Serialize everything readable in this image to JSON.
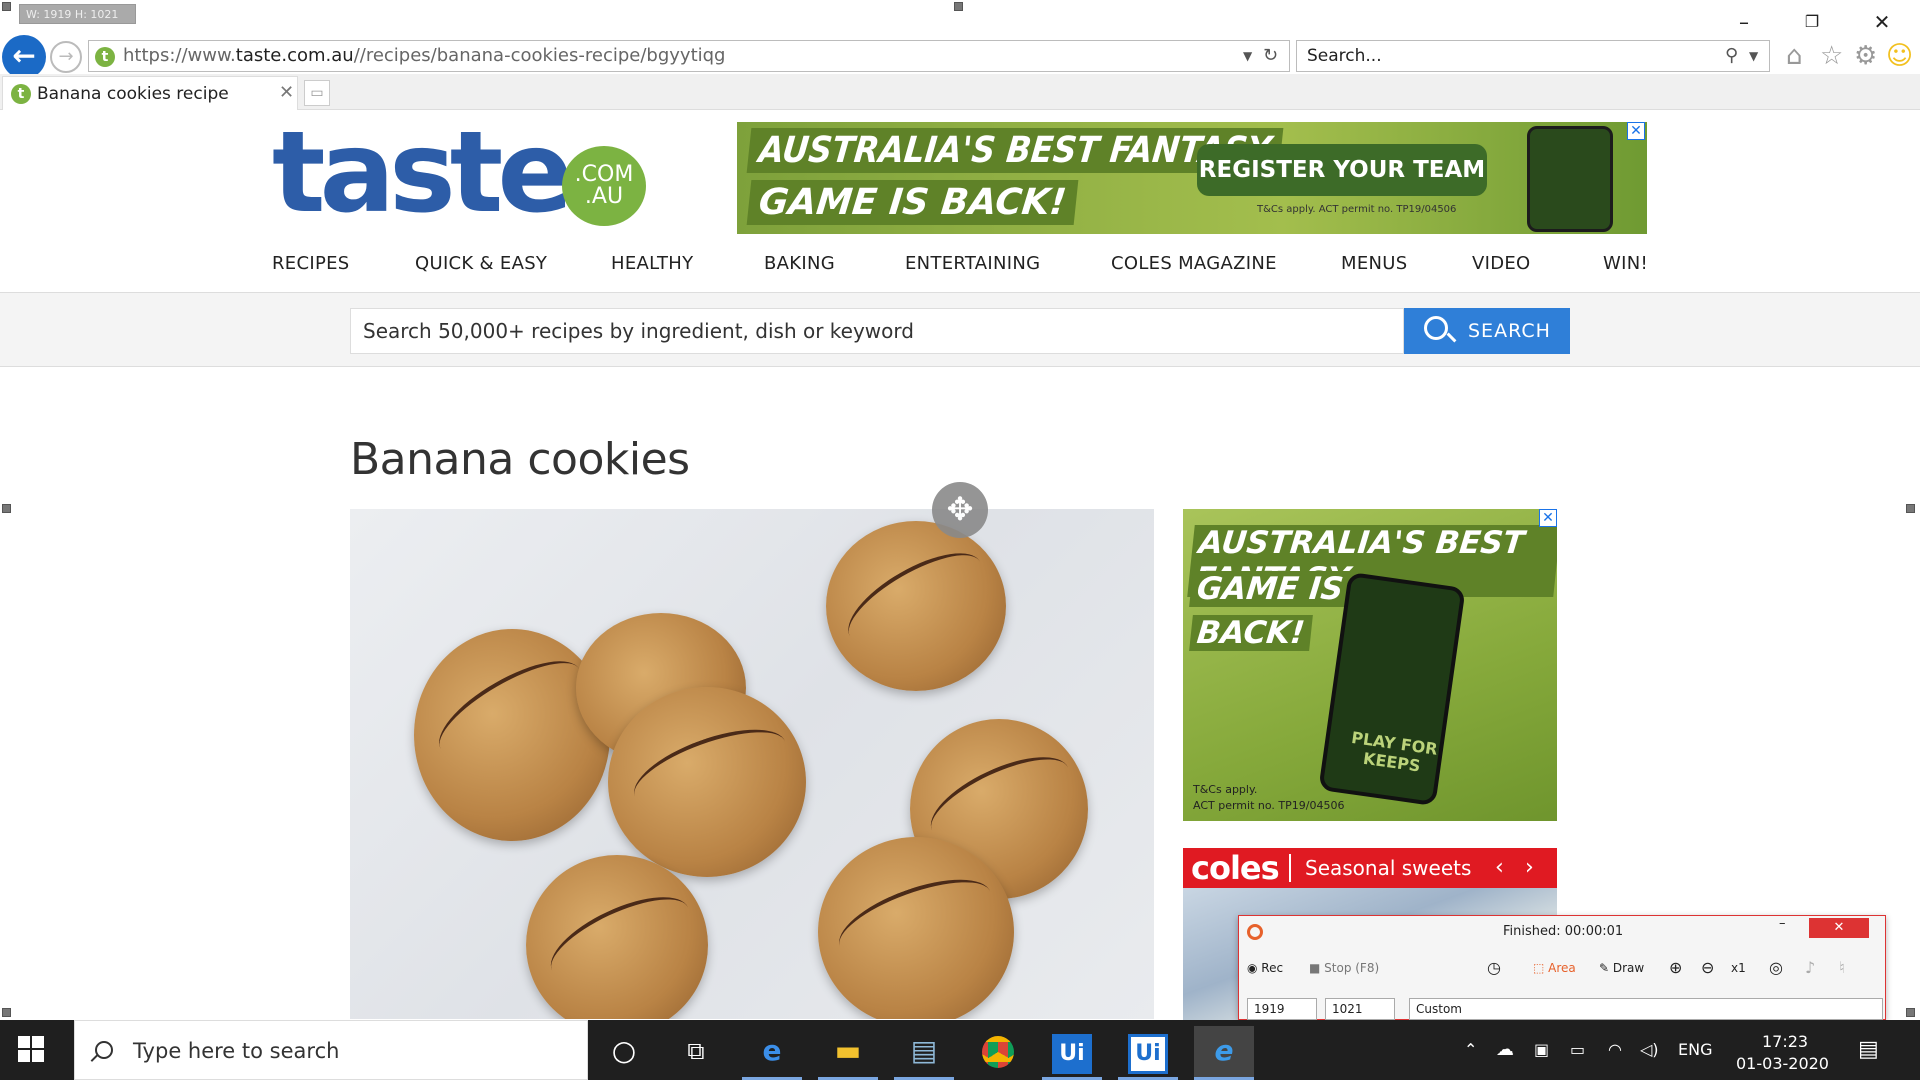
{
  "overlay": {
    "size_label": "W: 1919 H: 1021"
  },
  "browser": {
    "url_prefix": "https://www.",
    "url_domain": "taste.com.au",
    "url_path": "//recipes/banana-cookies-recipe/bgyytiqg",
    "search_placeholder": "Search...",
    "tab_title": "Banana cookies recipe",
    "favicon_letter": "t"
  },
  "site": {
    "logo_text": "taste",
    "logo_badge_1": ".COM",
    "logo_badge_2": ".AU",
    "banner": {
      "line1": "AUSTRALIA'S BEST FANTASY",
      "line2": "GAME IS BACK!",
      "cta": "REGISTER YOUR TEAM",
      "tcs": "T&Cs apply. ACT permit no. TP19/04506"
    },
    "nav": [
      "RECIPES",
      "QUICK & EASY",
      "HEALTHY",
      "BAKING",
      "ENTERTAINING",
      "COLES MAGAZINE",
      "MENUS",
      "VIDEO",
      "WIN!"
    ],
    "search_placeholder": "Search 50,000+ recipes by ingredient, dish or keyword",
    "search_button": "SEARCH",
    "page_title": "Banana cookies",
    "side_ad": {
      "line1": "AUSTRALIA'S BEST FANTASY",
      "line2": "GAME IS",
      "line3": "BACK!",
      "phone_text": "PLAY FOR KEEPS",
      "tcs1": "T&Cs apply.",
      "tcs2": "ACT permit no. TP19/04506"
    },
    "coles": {
      "logo": "coles",
      "title": "Seasonal sweets",
      "prev": "‹",
      "next": "›"
    }
  },
  "recorder": {
    "status": "Finished:  00:00:01",
    "rec": "Rec",
    "stop": "Stop (F8)",
    "area": "Area",
    "draw": "Draw",
    "zoom": "x1",
    "width": "1919",
    "height": "1021",
    "preset": "Custom",
    "minimize": "–",
    "close": "✕"
  },
  "taskbar": {
    "search_placeholder": "Type here to search",
    "lang": "ENG",
    "time": "17:23",
    "date": "01-03-2020"
  },
  "colors": {
    "accent": "#2f7fd8",
    "logo_blue": "#2d5da8",
    "logo_green": "#7cb342",
    "coles_red": "#e01a22"
  }
}
